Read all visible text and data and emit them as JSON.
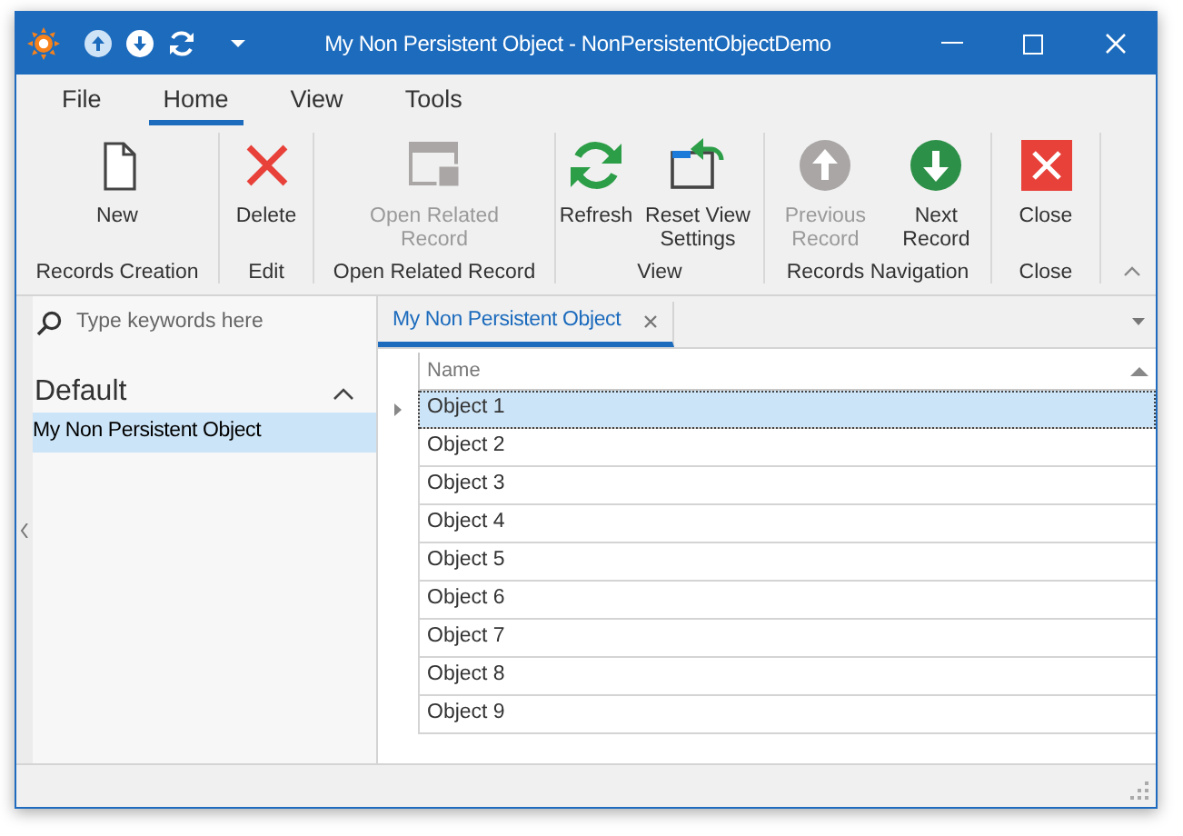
{
  "window": {
    "title": "My Non Persistent Object - NonPersistentObjectDemo"
  },
  "ribbon_tabs": [
    {
      "label": "File",
      "selected": false
    },
    {
      "label": "Home",
      "selected": true
    },
    {
      "label": "View",
      "selected": false
    },
    {
      "label": "Tools",
      "selected": false
    }
  ],
  "ribbon_groups": [
    {
      "label": "Records Creation",
      "buttons": [
        {
          "kind": "new",
          "label": "New",
          "disabled": false
        }
      ]
    },
    {
      "label": "Edit",
      "buttons": [
        {
          "kind": "delete",
          "label": "Delete",
          "disabled": false
        }
      ]
    },
    {
      "label": "Open Related Record",
      "buttons": [
        {
          "kind": "open",
          "label": "Open Related Record",
          "disabled": true
        }
      ]
    },
    {
      "label": "View",
      "buttons": [
        {
          "kind": "refresh",
          "label": "Refresh",
          "disabled": false
        },
        {
          "kind": "reset",
          "label": "Reset View Settings",
          "disabled": false
        }
      ]
    },
    {
      "label": "Records Navigation",
      "buttons": [
        {
          "kind": "previous",
          "label": "Previous Record",
          "disabled": true
        },
        {
          "kind": "next",
          "label": "Next Record",
          "disabled": false
        }
      ]
    },
    {
      "label": "Close",
      "buttons": [
        {
          "kind": "close",
          "label": "Close",
          "disabled": false
        }
      ]
    }
  ],
  "navigation": {
    "search": {
      "placeholder": "Type keywords here"
    },
    "groups": [
      {
        "label": "Default",
        "expanded": true,
        "items": [
          {
            "label": "My Non Persistent Object",
            "selected": true
          }
        ]
      }
    ]
  },
  "document_tabs": [
    {
      "label": "My Non Persistent Object",
      "selected": true
    }
  ],
  "grid": {
    "columns": [
      "Name"
    ],
    "rows": [
      {
        "name": "Object 1",
        "selected": true
      },
      {
        "name": "Object 2",
        "selected": false
      },
      {
        "name": "Object 3",
        "selected": false
      },
      {
        "name": "Object 4",
        "selected": false
      },
      {
        "name": "Object 5",
        "selected": false
      },
      {
        "name": "Object 6",
        "selected": false
      },
      {
        "name": "Object 7",
        "selected": false
      },
      {
        "name": "Object 8",
        "selected": false
      },
      {
        "name": "Object 9",
        "selected": false
      }
    ]
  }
}
